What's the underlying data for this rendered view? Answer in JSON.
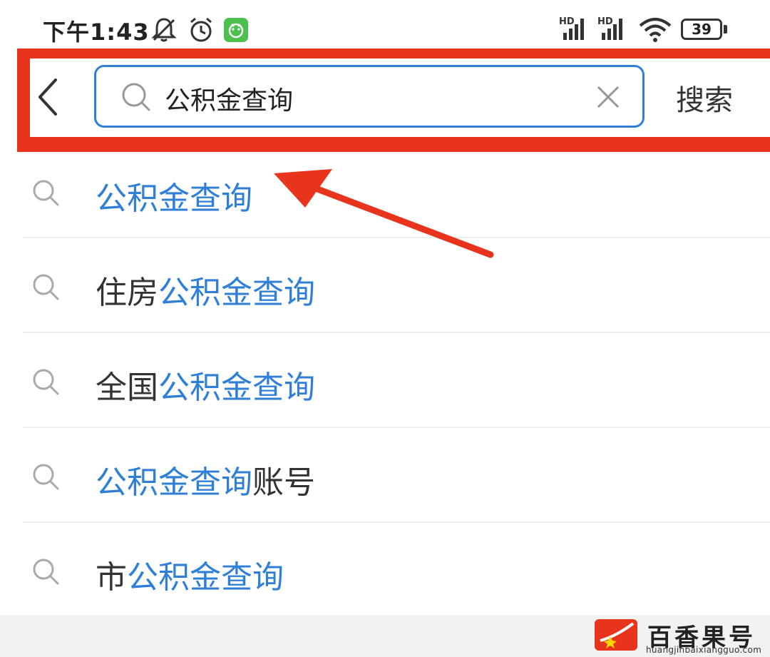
{
  "status_bar": {
    "time": "下午1:43",
    "battery": "39",
    "icons": [
      "mute-bell-icon",
      "alarm-icon",
      "app-notification-icon",
      "hd-signal-icon",
      "hd-signal-icon",
      "wifi-icon",
      "battery-icon"
    ]
  },
  "header": {
    "back_icon": "chevron-left-icon",
    "search_value": "公积金查询",
    "search_icon": "search-icon",
    "clear_icon": "close-icon",
    "search_button": "搜索"
  },
  "suggestions": [
    {
      "prefix": "",
      "match": "公积金查询",
      "suffix": ""
    },
    {
      "prefix": "住房",
      "match": "公积金查询",
      "suffix": ""
    },
    {
      "prefix": "全国",
      "match": "公积金查询",
      "suffix": ""
    },
    {
      "prefix": "",
      "match": "公积金查询",
      "suffix": "账号"
    },
    {
      "prefix": "市",
      "match": "公积金查询",
      "suffix": ""
    }
  ],
  "watermark": {
    "name": "百香果号",
    "url": "huangjinbaixiangguo.com"
  },
  "colors": {
    "highlight_red": "#e8341c",
    "accent_blue": "#2f7fd6"
  }
}
